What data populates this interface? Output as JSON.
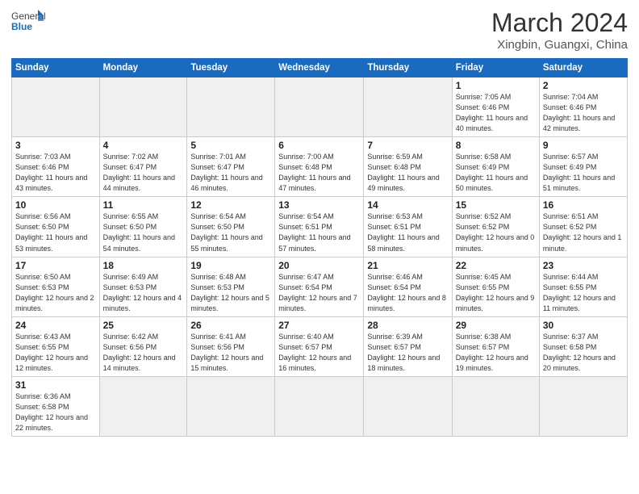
{
  "header": {
    "logo_general": "General",
    "logo_blue": "Blue",
    "title": "March 2024",
    "location": "Xingbin, Guangxi, China"
  },
  "days_of_week": [
    "Sunday",
    "Monday",
    "Tuesday",
    "Wednesday",
    "Thursday",
    "Friday",
    "Saturday"
  ],
  "weeks": [
    [
      {
        "day": "",
        "info": ""
      },
      {
        "day": "",
        "info": ""
      },
      {
        "day": "",
        "info": ""
      },
      {
        "day": "",
        "info": ""
      },
      {
        "day": "",
        "info": ""
      },
      {
        "day": "1",
        "info": "Sunrise: 7:05 AM\nSunset: 6:46 PM\nDaylight: 11 hours and 40 minutes."
      },
      {
        "day": "2",
        "info": "Sunrise: 7:04 AM\nSunset: 6:46 PM\nDaylight: 11 hours and 42 minutes."
      }
    ],
    [
      {
        "day": "3",
        "info": "Sunrise: 7:03 AM\nSunset: 6:46 PM\nDaylight: 11 hours and 43 minutes."
      },
      {
        "day": "4",
        "info": "Sunrise: 7:02 AM\nSunset: 6:47 PM\nDaylight: 11 hours and 44 minutes."
      },
      {
        "day": "5",
        "info": "Sunrise: 7:01 AM\nSunset: 6:47 PM\nDaylight: 11 hours and 46 minutes."
      },
      {
        "day": "6",
        "info": "Sunrise: 7:00 AM\nSunset: 6:48 PM\nDaylight: 11 hours and 47 minutes."
      },
      {
        "day": "7",
        "info": "Sunrise: 6:59 AM\nSunset: 6:48 PM\nDaylight: 11 hours and 49 minutes."
      },
      {
        "day": "8",
        "info": "Sunrise: 6:58 AM\nSunset: 6:49 PM\nDaylight: 11 hours and 50 minutes."
      },
      {
        "day": "9",
        "info": "Sunrise: 6:57 AM\nSunset: 6:49 PM\nDaylight: 11 hours and 51 minutes."
      }
    ],
    [
      {
        "day": "10",
        "info": "Sunrise: 6:56 AM\nSunset: 6:50 PM\nDaylight: 11 hours and 53 minutes."
      },
      {
        "day": "11",
        "info": "Sunrise: 6:55 AM\nSunset: 6:50 PM\nDaylight: 11 hours and 54 minutes."
      },
      {
        "day": "12",
        "info": "Sunrise: 6:54 AM\nSunset: 6:50 PM\nDaylight: 11 hours and 55 minutes."
      },
      {
        "day": "13",
        "info": "Sunrise: 6:54 AM\nSunset: 6:51 PM\nDaylight: 11 hours and 57 minutes."
      },
      {
        "day": "14",
        "info": "Sunrise: 6:53 AM\nSunset: 6:51 PM\nDaylight: 11 hours and 58 minutes."
      },
      {
        "day": "15",
        "info": "Sunrise: 6:52 AM\nSunset: 6:52 PM\nDaylight: 12 hours and 0 minutes."
      },
      {
        "day": "16",
        "info": "Sunrise: 6:51 AM\nSunset: 6:52 PM\nDaylight: 12 hours and 1 minute."
      }
    ],
    [
      {
        "day": "17",
        "info": "Sunrise: 6:50 AM\nSunset: 6:53 PM\nDaylight: 12 hours and 2 minutes."
      },
      {
        "day": "18",
        "info": "Sunrise: 6:49 AM\nSunset: 6:53 PM\nDaylight: 12 hours and 4 minutes."
      },
      {
        "day": "19",
        "info": "Sunrise: 6:48 AM\nSunset: 6:53 PM\nDaylight: 12 hours and 5 minutes."
      },
      {
        "day": "20",
        "info": "Sunrise: 6:47 AM\nSunset: 6:54 PM\nDaylight: 12 hours and 7 minutes."
      },
      {
        "day": "21",
        "info": "Sunrise: 6:46 AM\nSunset: 6:54 PM\nDaylight: 12 hours and 8 minutes."
      },
      {
        "day": "22",
        "info": "Sunrise: 6:45 AM\nSunset: 6:55 PM\nDaylight: 12 hours and 9 minutes."
      },
      {
        "day": "23",
        "info": "Sunrise: 6:44 AM\nSunset: 6:55 PM\nDaylight: 12 hours and 11 minutes."
      }
    ],
    [
      {
        "day": "24",
        "info": "Sunrise: 6:43 AM\nSunset: 6:55 PM\nDaylight: 12 hours and 12 minutes."
      },
      {
        "day": "25",
        "info": "Sunrise: 6:42 AM\nSunset: 6:56 PM\nDaylight: 12 hours and 14 minutes."
      },
      {
        "day": "26",
        "info": "Sunrise: 6:41 AM\nSunset: 6:56 PM\nDaylight: 12 hours and 15 minutes."
      },
      {
        "day": "27",
        "info": "Sunrise: 6:40 AM\nSunset: 6:57 PM\nDaylight: 12 hours and 16 minutes."
      },
      {
        "day": "28",
        "info": "Sunrise: 6:39 AM\nSunset: 6:57 PM\nDaylight: 12 hours and 18 minutes."
      },
      {
        "day": "29",
        "info": "Sunrise: 6:38 AM\nSunset: 6:57 PM\nDaylight: 12 hours and 19 minutes."
      },
      {
        "day": "30",
        "info": "Sunrise: 6:37 AM\nSunset: 6:58 PM\nDaylight: 12 hours and 20 minutes."
      }
    ],
    [
      {
        "day": "31",
        "info": "Sunrise: 6:36 AM\nSunset: 6:58 PM\nDaylight: 12 hours and 22 minutes."
      },
      {
        "day": "",
        "info": ""
      },
      {
        "day": "",
        "info": ""
      },
      {
        "day": "",
        "info": ""
      },
      {
        "day": "",
        "info": ""
      },
      {
        "day": "",
        "info": ""
      },
      {
        "day": "",
        "info": ""
      }
    ]
  ]
}
